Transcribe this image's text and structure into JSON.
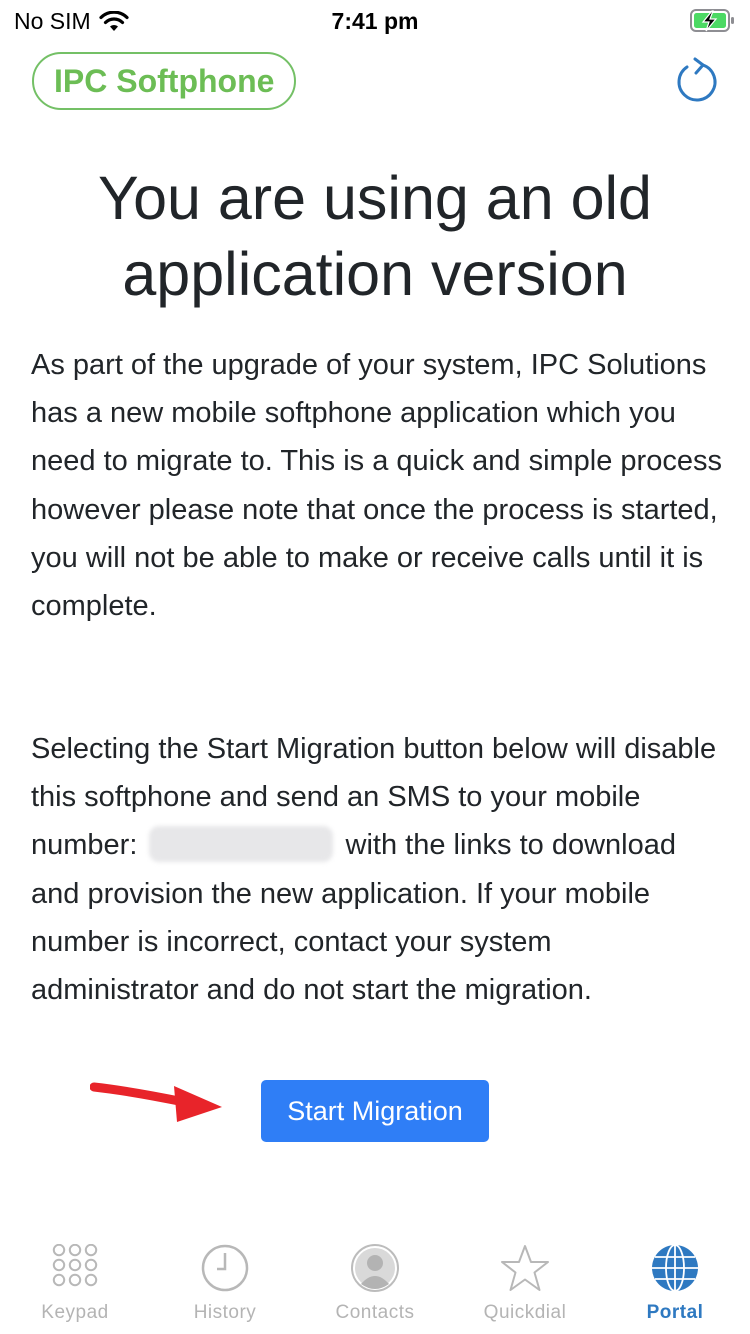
{
  "status_bar": {
    "carrier": "No SIM",
    "time": "7:41 pm"
  },
  "header": {
    "brand": "IPC Softphone",
    "brand_color": "#6cbd55",
    "refresh_icon": "refresh-icon"
  },
  "content": {
    "title": "You are using an old application version",
    "paragraph1": "As part of the upgrade of your system, IPC Solutions has a new mobile softphone application which you need to migrate to. This is a quick and simple process however please note that once the process is started, you will not be able to make or receive calls until it is complete.",
    "paragraph2_before": "Selecting the Start Migration button below will disable this softphone and send an SMS to your mobile number:",
    "paragraph2_after": "with the links to download and provision the new application. If your mobile number is incorrect, contact your system administrator and do not start the migration.",
    "start_button": "Start Migration",
    "button_color": "#2f7ef6",
    "annotation_arrow_color": "#e8242a"
  },
  "tabs": [
    {
      "label": "Keypad",
      "icon": "keypad-icon",
      "active": false
    },
    {
      "label": "History",
      "icon": "clock-icon",
      "active": false
    },
    {
      "label": "Contacts",
      "icon": "person-icon",
      "active": false
    },
    {
      "label": "Quickdial",
      "icon": "star-icon",
      "active": false
    },
    {
      "label": "Portal",
      "icon": "globe-icon",
      "active": true
    }
  ],
  "active_tab_color": "#2e79c1"
}
